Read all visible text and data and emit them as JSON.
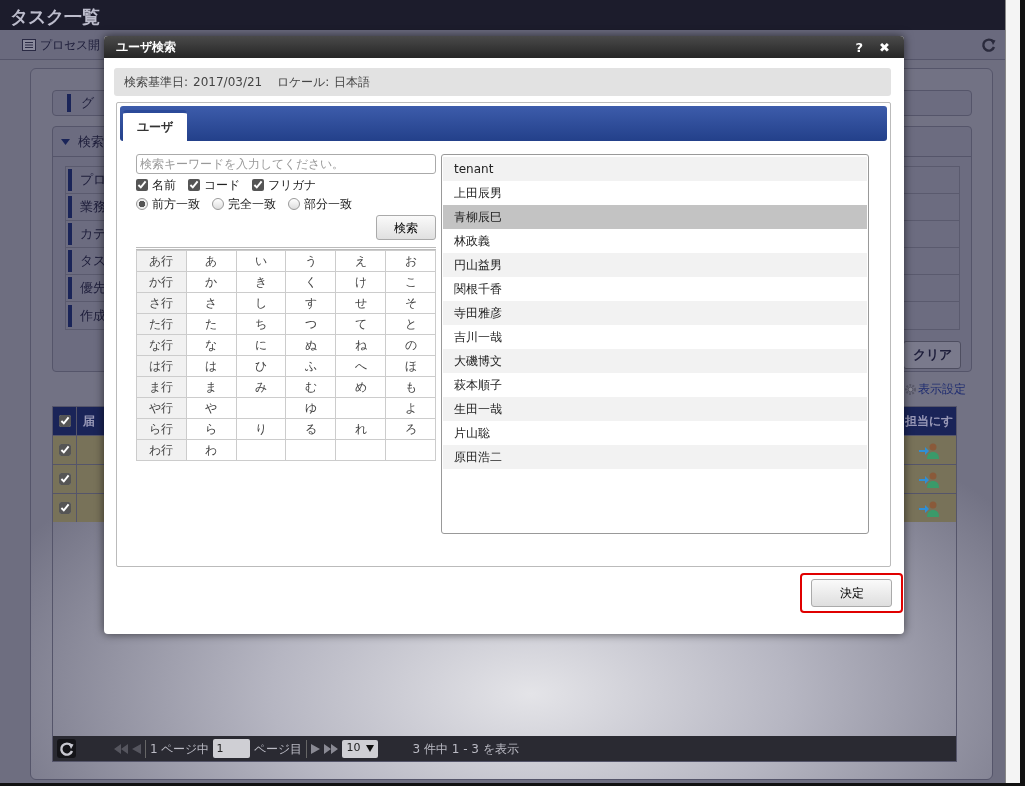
{
  "page": {
    "title": "タスク一覧"
  },
  "toolbar": {
    "tab_label": "プロセス開"
  },
  "group_header": "グ",
  "search_panel": {
    "title": "検索",
    "expanded": true,
    "conditions": [
      "プロ",
      "業務",
      "カテ",
      "タス",
      "優先",
      "作成"
    ],
    "clear_button": "クリア"
  },
  "display_settings_link": "表示設定",
  "task_table": {
    "header_checked": true,
    "columns": [
      "届",
      "担当にす"
    ],
    "rows": [
      {
        "checked": true
      },
      {
        "checked": true
      },
      {
        "checked": true
      }
    ]
  },
  "pager": {
    "page_count_text": "1 ページ中",
    "page": "1",
    "page_suffix": "ページ目",
    "page_size": "10",
    "summary": "3 件中 1 - 3 を表示"
  },
  "dialog": {
    "title": "ユーザ検索",
    "help": "?",
    "close": "✖",
    "info": {
      "date_label": "検索基準日:",
      "date": "2017/03/21",
      "locale_label": "ロケール:",
      "locale": "日本語"
    },
    "tabs": [
      {
        "label": "ユーザ",
        "selected": true
      }
    ],
    "search": {
      "placeholder": "検索キーワードを入力してください。",
      "fields": [
        {
          "label": "名前",
          "checked": true
        },
        {
          "label": "コード",
          "checked": true
        },
        {
          "label": "フリガナ",
          "checked": true
        }
      ],
      "match_modes": [
        {
          "label": "前方一致",
          "selected": true
        },
        {
          "label": "完全一致",
          "selected": false
        },
        {
          "label": "部分一致",
          "selected": false
        }
      ],
      "button": "検索"
    },
    "kana_table": {
      "rows": [
        {
          "label": "あ行",
          "kana": [
            {
              "text": "あ"
            },
            {
              "text": "い"
            },
            {
              "text": "う"
            },
            {
              "text": "え"
            },
            {
              "text": "お"
            }
          ]
        },
        {
          "label": "か行",
          "kana": [
            {
              "text": "か"
            },
            {
              "text": "き"
            },
            {
              "text": "く"
            },
            {
              "text": "け"
            },
            {
              "text": "こ"
            }
          ]
        },
        {
          "label": "さ行",
          "kana": [
            {
              "text": "さ"
            },
            {
              "text": "し"
            },
            {
              "text": "す"
            },
            {
              "text": "せ"
            },
            {
              "text": "そ"
            }
          ]
        },
        {
          "label": "た行",
          "kana": [
            {
              "text": "た"
            },
            {
              "text": "ち"
            },
            {
              "text": "つ"
            },
            {
              "text": "て"
            },
            {
              "text": "と"
            }
          ]
        },
        {
          "label": "な行",
          "kana": [
            {
              "text": "な"
            },
            {
              "text": "に"
            },
            {
              "text": "ぬ"
            },
            {
              "text": "ね"
            },
            {
              "text": "の"
            }
          ]
        },
        {
          "label": "は行",
          "kana": [
            {
              "text": "は"
            },
            {
              "text": "ひ"
            },
            {
              "text": "ふ"
            },
            {
              "text": "へ"
            },
            {
              "text": "ほ"
            }
          ]
        },
        {
          "label": "ま行",
          "kana": [
            {
              "text": "ま"
            },
            {
              "text": "み"
            },
            {
              "text": "む"
            },
            {
              "text": "め"
            },
            {
              "text": "も"
            }
          ]
        },
        {
          "label": "や行",
          "kana": [
            {
              "text": "や"
            },
            {
              "empty": true
            },
            {
              "text": "ゆ"
            },
            {
              "empty": true
            },
            {
              "text": "よ"
            }
          ]
        },
        {
          "label": "ら行",
          "kana": [
            {
              "text": "ら"
            },
            {
              "text": "り"
            },
            {
              "text": "る"
            },
            {
              "text": "れ"
            },
            {
              "text": "ろ"
            }
          ]
        },
        {
          "label": "わ行",
          "kana": [
            {
              "text": "わ"
            },
            {
              "empty": true
            },
            {
              "empty": true
            },
            {
              "empty": true
            },
            {
              "empty": true
            }
          ]
        }
      ]
    },
    "users": [
      {
        "name": "tenant",
        "selected": false
      },
      {
        "name": "上田辰男",
        "selected": false
      },
      {
        "name": "青柳辰巳",
        "selected": true
      },
      {
        "name": "林政義",
        "selected": false
      },
      {
        "name": "円山益男",
        "selected": false
      },
      {
        "name": "関根千香",
        "selected": false
      },
      {
        "name": "寺田雅彦",
        "selected": false
      },
      {
        "name": "吉川一哉",
        "selected": false
      },
      {
        "name": "大磯博文",
        "selected": false
      },
      {
        "name": "萩本順子",
        "selected": false
      },
      {
        "name": "生田一哉",
        "selected": false
      },
      {
        "name": "片山聡",
        "selected": false
      },
      {
        "name": "原田浩二",
        "selected": false
      }
    ],
    "ok_button": "決定",
    "ok_highlighted": true
  }
}
